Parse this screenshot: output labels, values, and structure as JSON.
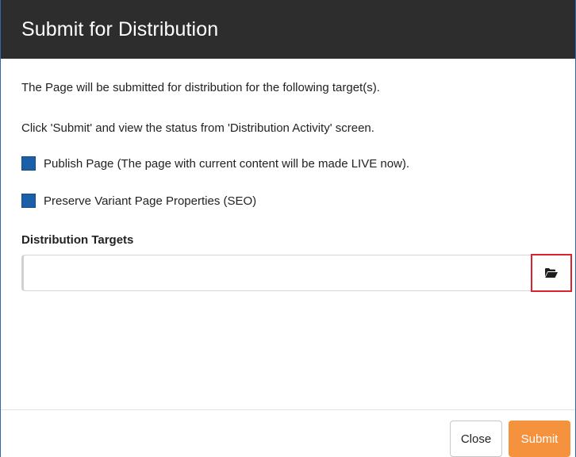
{
  "dialog": {
    "title": "Submit for Distribution",
    "intro_text": "The Page will be submitted for distribution for the following target(s).",
    "instruction_text": "Click 'Submit' and view the status from 'Distribution Activity' screen.",
    "options": [
      {
        "label": "Publish Page (The page with current content will be made LIVE now).",
        "checked": true
      },
      {
        "label": "Preserve Variant Page Properties (SEO)",
        "checked": true
      }
    ],
    "targets": {
      "label": "Distribution Targets",
      "value": "",
      "browse_icon": "folder-open-icon"
    },
    "footer": {
      "close_label": "Close",
      "submit_label": "Submit"
    }
  },
  "colors": {
    "header_bg": "#2d2d2d",
    "checkbox": "#1a5fa8",
    "submit_button": "#f5923e",
    "highlight_border": "#d9232d"
  }
}
